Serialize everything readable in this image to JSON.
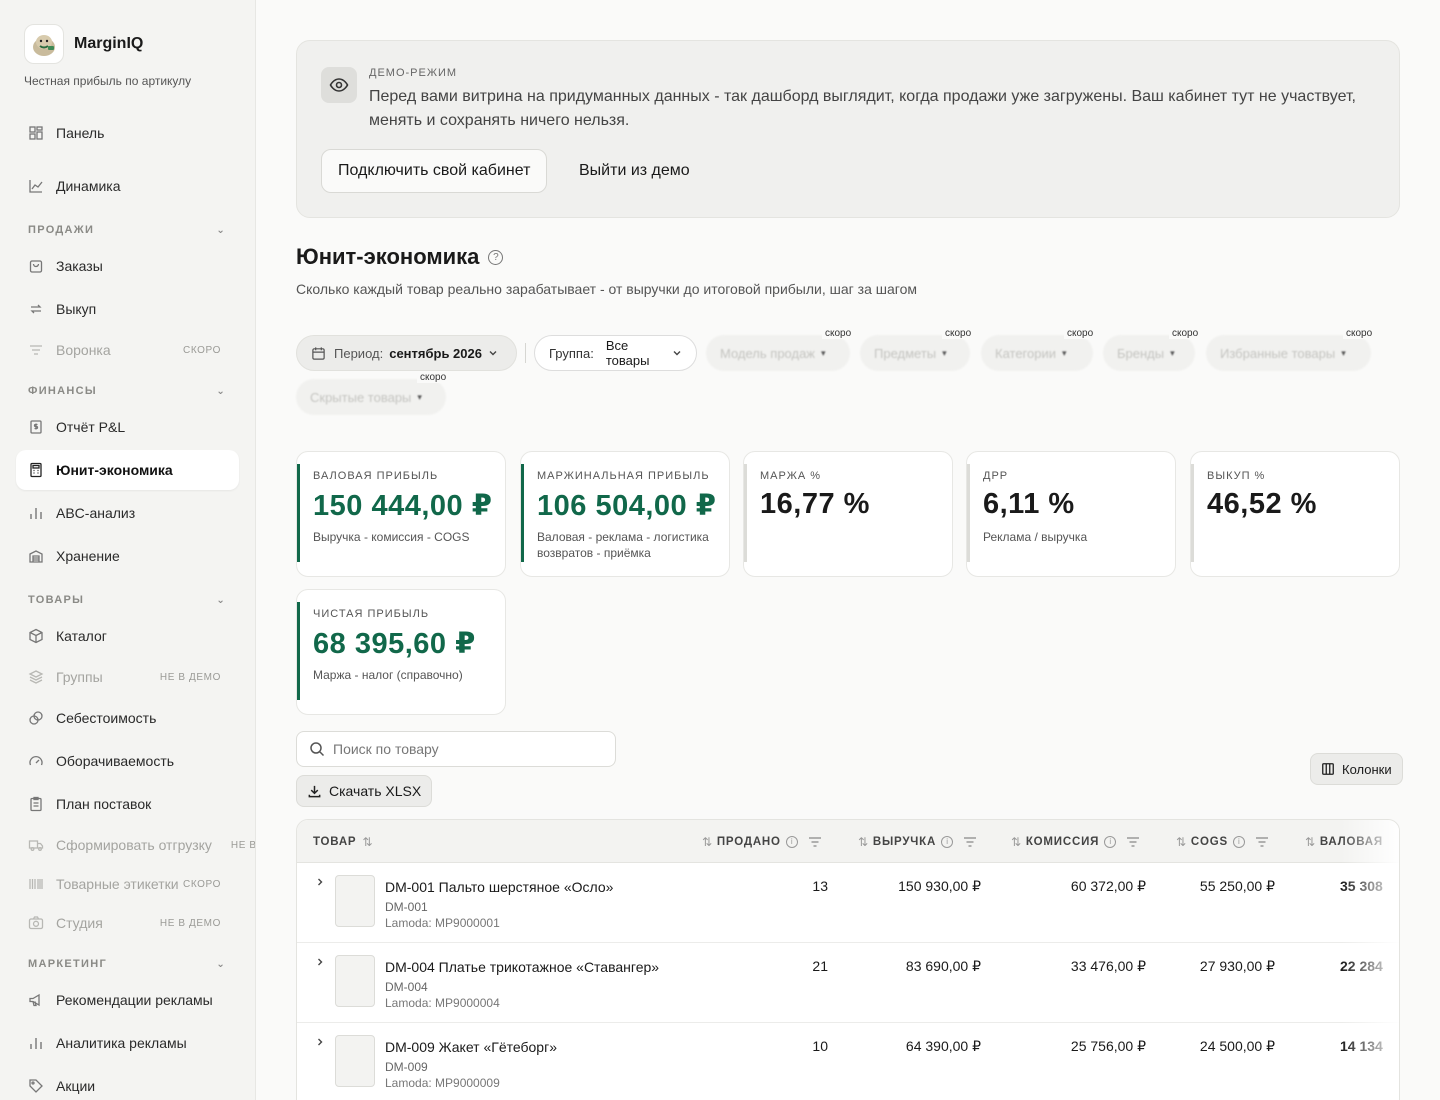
{
  "brand": {
    "name": "MarginIQ",
    "tagline": "Честная прибыль по артикулу"
  },
  "sidebar": {
    "top_items": [
      {
        "label": "Панель",
        "icon": "dashboard-icon"
      },
      {
        "label": "Динамика",
        "icon": "line-chart-icon"
      }
    ],
    "sections": [
      {
        "title": "ПРОДАЖИ"
      },
      {
        "title": "ФИНАНСЫ"
      },
      {
        "title": "ТОВАРЫ"
      },
      {
        "title": "МАРКЕТИНГ"
      }
    ],
    "items": {
      "orders": "Заказы",
      "buyout": "Выкуп",
      "funnel": "Воронка",
      "funnel_tag": "СКОРО",
      "pnl": "Отчёт P&L",
      "unit": "Юнит-экономика",
      "abc": "ABC-анализ",
      "storage": "Хранение",
      "catalog": "Каталог",
      "groups": "Группы",
      "groups_tag": "НЕ В ДЕМО",
      "cost": "Себестоимость",
      "turnover": "Оборачиваемость",
      "supply_plan": "План поставок",
      "shipment": "Сформировать отгрузку",
      "shipment_tag": "НЕ В ДЕМО",
      "labels": "Товарные этикетки",
      "labels_tag": "СКОРО",
      "studio": "Студия",
      "studio_tag": "НЕ В ДЕМО",
      "ads_reco": "Рекомендации рекламы",
      "ads_analytics": "Аналитика рекламы",
      "promos": "Акции"
    }
  },
  "demo": {
    "label": "ДЕМО-РЕЖИМ",
    "text": "Перед вами витрина на придуманных данных - так дашборд выглядит, когда продажи уже загружены. Ваш кабинет тут не участвует, менять и сохранять ничего нельзя.",
    "connect_label": "Подключить свой кабинет",
    "exit_label": "Выйти из демо"
  },
  "page": {
    "title": "Юнит-экономика",
    "subtitle": "Сколько каждый товар реально зарабатывает - от выручки до итоговой прибыли, шаг за шагом"
  },
  "filters": {
    "period_label": "Период:",
    "period_value": "сентябрь 2026",
    "group_label": "Группа:",
    "group_value": "Все товары",
    "disabled": [
      "Модель продаж",
      "Предметы",
      "Категории",
      "Бренды",
      "Избранные товары",
      "Скрытые товары"
    ],
    "soon_label": "скоро"
  },
  "kpis": [
    {
      "title": "ВАЛОВАЯ ПРИБЫЛЬ",
      "value": "150 444,00 ₽",
      "desc": "Выручка - комиссия - COGS"
    },
    {
      "title": "МАРЖИНАЛЬНАЯ ПРИБЫЛЬ",
      "value": "106 504,00 ₽",
      "desc": "Валовая - реклама - логистика возвратов - приёмка"
    },
    {
      "title": "МАРЖА %",
      "value": "16,77 %",
      "desc": ""
    },
    {
      "title": "ДРР",
      "value": "6,11 %",
      "desc": "Реклама / выручка"
    },
    {
      "title": "ВЫКУП %",
      "value": "46,52 %",
      "desc": ""
    },
    {
      "title": "ЧИСТАЯ ПРИБЫЛЬ",
      "value": "68 395,60 ₽",
      "desc": "Маржа - налог (справочно)"
    }
  ],
  "table_tools": {
    "search_placeholder": "Поиск по товару",
    "download_label": "Скачать XLSX",
    "columns_label": "Колонки"
  },
  "table": {
    "headers": {
      "product": "ТОВАР",
      "sold": "ПРОДАНО",
      "revenue": "ВЫРУЧКА",
      "commission": "КОМИССИЯ",
      "cogs": "COGS",
      "gross": "ВАЛОВАЯ"
    },
    "rows": [
      {
        "name": "DM-001 Пальто шерстяное «Осло»",
        "sku": "DM-001",
        "mp": "Lamoda: MP9000001",
        "sold": "13",
        "revenue": "150 930,00 ₽",
        "commission": "60 372,00 ₽",
        "cogs": "55 250,00 ₽",
        "gross": "35 308"
      },
      {
        "name": "DM-004 Платье трикотажное «Ставангер»",
        "sku": "DM-004",
        "mp": "Lamoda: MP9000004",
        "sold": "21",
        "revenue": "83 690,00 ₽",
        "commission": "33 476,00 ₽",
        "cogs": "27 930,00 ₽",
        "gross": "22 284"
      },
      {
        "name": "DM-009 Жакет «Гётеборг»",
        "sku": "DM-009",
        "mp": "Lamoda: MP9000009",
        "sold": "10",
        "revenue": "64 390,00 ₽",
        "commission": "25 756,00 ₽",
        "cogs": "24 500,00 ₽",
        "gross": "14 134"
      }
    ]
  },
  "colors": {
    "accent_green": "#11684a",
    "active_bg": "#ffffff",
    "sidebar_bg": "#f4f4f2"
  }
}
